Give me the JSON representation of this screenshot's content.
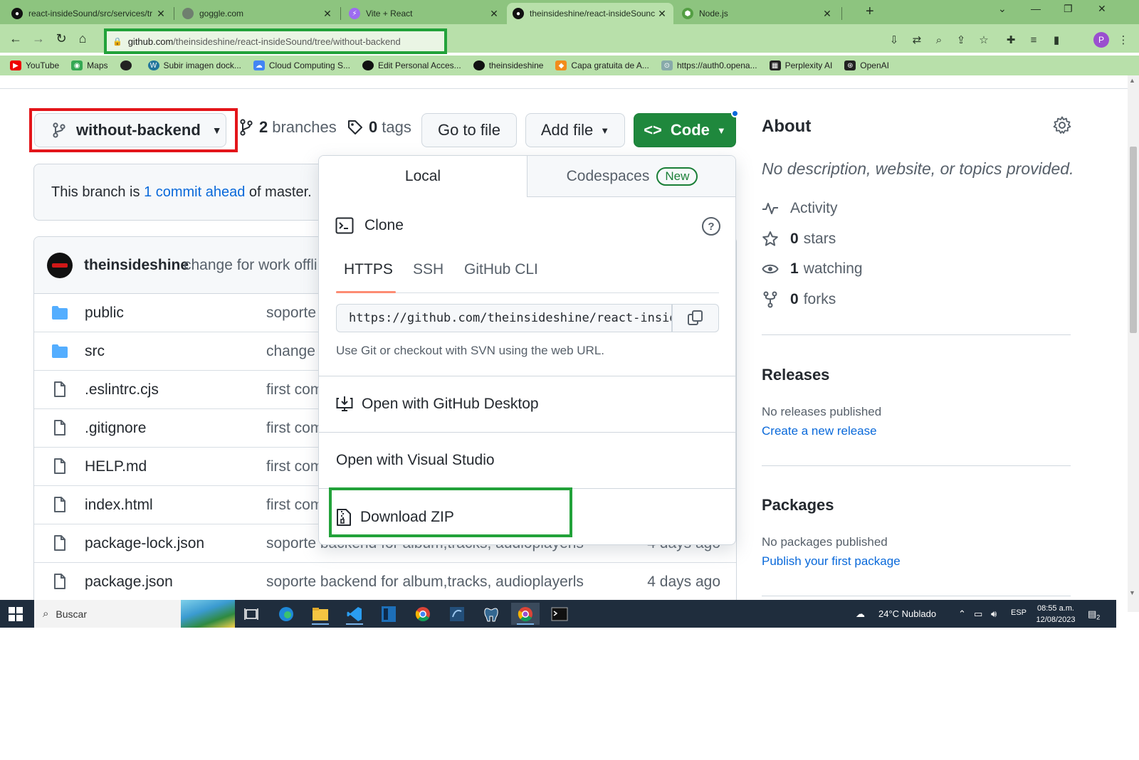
{
  "browser": {
    "tabs": [
      {
        "title": "react-insideSound/src/services/tr"
      },
      {
        "title": "goggle.com"
      },
      {
        "title": "Vite + React"
      },
      {
        "title": "theinsideshine/react-insideSounc"
      },
      {
        "title": "Node.js"
      }
    ],
    "url_host": "github.com",
    "url_path": "/theinsideshine/react-insideSound/tree/without-backend",
    "profile_initial": "P",
    "bookmarks": [
      {
        "label": "YouTube"
      },
      {
        "label": "Maps"
      },
      {
        "label": ""
      },
      {
        "label": "Subir imagen dock..."
      },
      {
        "label": "Cloud Computing S..."
      },
      {
        "label": "Edit Personal Acces..."
      },
      {
        "label": "theinsideshine"
      },
      {
        "label": "Capa gratuita de A..."
      },
      {
        "label": "https://auth0.opena..."
      },
      {
        "label": "Perplexity AI"
      },
      {
        "label": "OpenAI"
      }
    ]
  },
  "repo": {
    "branch": "without-backend",
    "branches_count": "2",
    "branches_label": "branches",
    "tags_count": "0",
    "tags_label": "tags",
    "goto_file": "Go to file",
    "add_file": "Add file",
    "code": "Code",
    "ahead_prefix": "This branch is ",
    "ahead_link": "1 commit ahead",
    "ahead_suffix": " of master.",
    "commit_author": "theinsideshine",
    "commit_message": "change for work offli",
    "files": [
      {
        "name": "public",
        "type": "folder",
        "message": "soporte",
        "age": ""
      },
      {
        "name": "src",
        "type": "folder",
        "message": "change",
        "age": ""
      },
      {
        "name": ".eslintrc.cjs",
        "type": "file",
        "message": "first com",
        "age": ""
      },
      {
        "name": ".gitignore",
        "type": "file",
        "message": "first com",
        "age": ""
      },
      {
        "name": "HELP.md",
        "type": "file",
        "message": "first com",
        "age": ""
      },
      {
        "name": "index.html",
        "type": "file",
        "message": "first com",
        "age": ""
      },
      {
        "name": "package-lock.json",
        "type": "file",
        "message": "soporte backend for album,tracks, audioplayerls",
        "age": "4 days ago"
      },
      {
        "name": "package.json",
        "type": "file",
        "message": "soporte backend for album,tracks, audioplayerls",
        "age": "4 days ago"
      }
    ]
  },
  "code_dropdown": {
    "tab_local": "Local",
    "tab_codespaces": "Codespaces",
    "new_badge": "New",
    "clone_title": "Clone",
    "protocols": [
      "HTTPS",
      "SSH",
      "GitHub CLI"
    ],
    "clone_url": "https://github.com/theinsideshine/react-insideSound.git",
    "clone_hint": "Use Git or checkout with SVN using the web URL.",
    "open_desktop": "Open with GitHub Desktop",
    "open_vs": "Open with Visual Studio",
    "download_zip": "Download ZIP"
  },
  "sidebar": {
    "about_title": "About",
    "description": "No description, website, or topics provided.",
    "activity": "Activity",
    "stars_count": "0",
    "stars_label": "stars",
    "watching_count": "1",
    "watching_label": "watching",
    "forks_count": "0",
    "forks_label": "forks",
    "releases_title": "Releases",
    "releases_none": "No releases published",
    "releases_link": "Create a new release",
    "packages_title": "Packages",
    "packages_none": "No packages published",
    "packages_link": "Publish your first package"
  },
  "taskbar": {
    "search_placeholder": "Buscar",
    "weather": "24°C  Nublado",
    "language": "ESP",
    "time": "08:55 a.m.",
    "date": "12/08/2023",
    "notifications": "2"
  },
  "colors": {
    "chrome_green": "#8dc47f",
    "toolbar_green": "#b8e0aa",
    "highlight_red": "#e3151a",
    "highlight_green": "#22a23a",
    "github_green": "#1f883d",
    "link_blue": "#0969da"
  }
}
